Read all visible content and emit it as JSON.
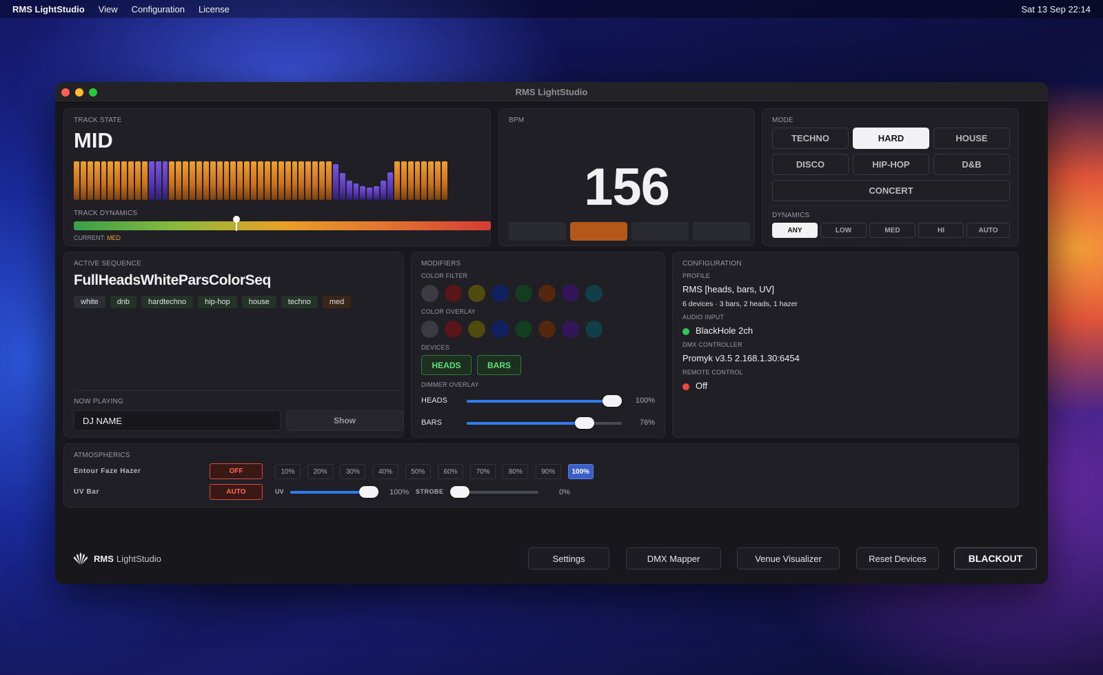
{
  "menubar": {
    "app": "RMS LightStudio",
    "items": [
      "View",
      "Configuration",
      "License"
    ],
    "clock": "Sat 13 Sep  22:14"
  },
  "window": {
    "title": "RMS LightStudio"
  },
  "track_state": {
    "label": "TRACK STATE",
    "value": "MID",
    "dynamics_label": "TRACK DYNAMICS",
    "current_prefix": "CURRENT:",
    "current_value": "MED",
    "dynamics_level": 0.39,
    "bars": [
      {
        "h": 1.0,
        "c": "orange"
      },
      {
        "h": 1.0,
        "c": "orange"
      },
      {
        "h": 1.0,
        "c": "orange"
      },
      {
        "h": 1.0,
        "c": "orange"
      },
      {
        "h": 1.0,
        "c": "orange"
      },
      {
        "h": 1.0,
        "c": "orange"
      },
      {
        "h": 1.0,
        "c": "orange"
      },
      {
        "h": 1.0,
        "c": "orange"
      },
      {
        "h": 1.0,
        "c": "orange"
      },
      {
        "h": 1.0,
        "c": "orange"
      },
      {
        "h": 1.0,
        "c": "orange"
      },
      {
        "h": 1.0,
        "c": "purple"
      },
      {
        "h": 1.0,
        "c": "purple"
      },
      {
        "h": 1.0,
        "c": "purple"
      },
      {
        "h": 1.0,
        "c": "orange"
      },
      {
        "h": 1.0,
        "c": "orange"
      },
      {
        "h": 1.0,
        "c": "orange"
      },
      {
        "h": 1.0,
        "c": "orange"
      },
      {
        "h": 1.0,
        "c": "orange"
      },
      {
        "h": 1.0,
        "c": "orange"
      },
      {
        "h": 1.0,
        "c": "orange"
      },
      {
        "h": 1.0,
        "c": "orange"
      },
      {
        "h": 1.0,
        "c": "orange"
      },
      {
        "h": 1.0,
        "c": "orange"
      },
      {
        "h": 1.0,
        "c": "orange"
      },
      {
        "h": 1.0,
        "c": "orange"
      },
      {
        "h": 1.0,
        "c": "orange"
      },
      {
        "h": 1.0,
        "c": "orange"
      },
      {
        "h": 1.0,
        "c": "orange"
      },
      {
        "h": 1.0,
        "c": "orange"
      },
      {
        "h": 1.0,
        "c": "orange"
      },
      {
        "h": 1.0,
        "c": "orange"
      },
      {
        "h": 1.0,
        "c": "orange"
      },
      {
        "h": 1.0,
        "c": "orange"
      },
      {
        "h": 1.0,
        "c": "orange"
      },
      {
        "h": 1.0,
        "c": "orange"
      },
      {
        "h": 1.0,
        "c": "orange"
      },
      {
        "h": 1.0,
        "c": "orange"
      },
      {
        "h": 0.92,
        "c": "purple"
      },
      {
        "h": 0.7,
        "c": "purple"
      },
      {
        "h": 0.5,
        "c": "purple"
      },
      {
        "h": 0.42,
        "c": "purple"
      },
      {
        "h": 0.35,
        "c": "purple"
      },
      {
        "h": 0.33,
        "c": "purple"
      },
      {
        "h": 0.36,
        "c": "purple"
      },
      {
        "h": 0.5,
        "c": "purple"
      },
      {
        "h": 0.72,
        "c": "purple"
      },
      {
        "h": 1.0,
        "c": "orange"
      },
      {
        "h": 1.0,
        "c": "orange"
      },
      {
        "h": 1.0,
        "c": "orange"
      },
      {
        "h": 1.0,
        "c": "orange"
      },
      {
        "h": 1.0,
        "c": "orange"
      },
      {
        "h": 1.0,
        "c": "orange"
      },
      {
        "h": 1.0,
        "c": "orange"
      },
      {
        "h": 1.0,
        "c": "orange"
      }
    ]
  },
  "bpm": {
    "label": "BPM",
    "value": "156",
    "beats": [
      false,
      true,
      false,
      false
    ]
  },
  "mode": {
    "label": "MODE",
    "buttons": [
      "TECHNO",
      "HARD",
      "HOUSE",
      "DISCO",
      "HIP-HOP",
      "D&B",
      "CONCERT"
    ],
    "active": "HARD",
    "dynamics_label": "DYNAMICS",
    "dynamics": [
      "ANY",
      "LOW",
      "MED",
      "HI",
      "AUTO"
    ],
    "dynamics_active": "ANY"
  },
  "sequence": {
    "label": "ACTIVE SEQUENCE",
    "name": "FullHeadsWhiteParsColorSeq",
    "tags": [
      "white",
      "dnb",
      "hardtechno",
      "hip-hop",
      "house",
      "techno",
      "med"
    ],
    "now_playing_label": "NOW PLAYING",
    "now_playing_value": "DJ NAME",
    "show_button": "Show"
  },
  "modifiers": {
    "label": "MODIFIERS",
    "color_filter_label": "COLOR FILTER",
    "color_overlay_label": "COLOR OVERLAY",
    "swatches": [
      "#3a3a3f",
      "#5a1518",
      "#4f4a0d",
      "#0f2160",
      "#123d20",
      "#55270f",
      "#34155a",
      "#123e48"
    ],
    "devices_label": "DEVICES",
    "devices": [
      "HEADS",
      "BARS"
    ],
    "dimmer_label": "DIMMER OVERLAY",
    "dimmers": [
      {
        "name": "HEADS",
        "percent": "100%",
        "level": 1.0
      },
      {
        "name": "BARS",
        "percent": "76%",
        "level": 0.76
      }
    ]
  },
  "configuration": {
    "label": "CONFIGURATION",
    "profile_label": "PROFILE",
    "profile": "RMS [heads, bars, UV]",
    "profile_detail": "6 devices  ·  3 bars, 2 heads, 1 hazer",
    "audio_label": "AUDIO INPUT",
    "audio": "BlackHole 2ch",
    "audio_color": "#2ecc55",
    "dmx_label": "DMX CONTROLLER",
    "dmx": "Promyk v3.5  2.168.1.30:6454",
    "remote_label": "REMOTE CONTROL",
    "remote": "Off",
    "remote_color": "#f04a3a"
  },
  "atmospherics": {
    "label": "ATMOSPHERICS",
    "hazer_name": "Entour Faze Hazer",
    "hazer_button": "OFF",
    "percents": [
      "10%",
      "20%",
      "30%",
      "40%",
      "50%",
      "60%",
      "70%",
      "80%",
      "90%",
      "100%"
    ],
    "percent_active": "100%",
    "uv_name": "UV Bar",
    "uv_button": "AUTO",
    "uv_label": "UV",
    "uv_percent": "100%",
    "uv_level": 1.0,
    "strobe_label": "STROBE",
    "strobe_percent": "0%",
    "strobe_level": 0.0
  },
  "footer": {
    "brand_bold": "RMS",
    "brand_rest": "LightStudio",
    "buttons": [
      "Settings",
      "DMX Mapper",
      "Venue Visualizer",
      "Reset Devices",
      "BLACKOUT"
    ]
  }
}
